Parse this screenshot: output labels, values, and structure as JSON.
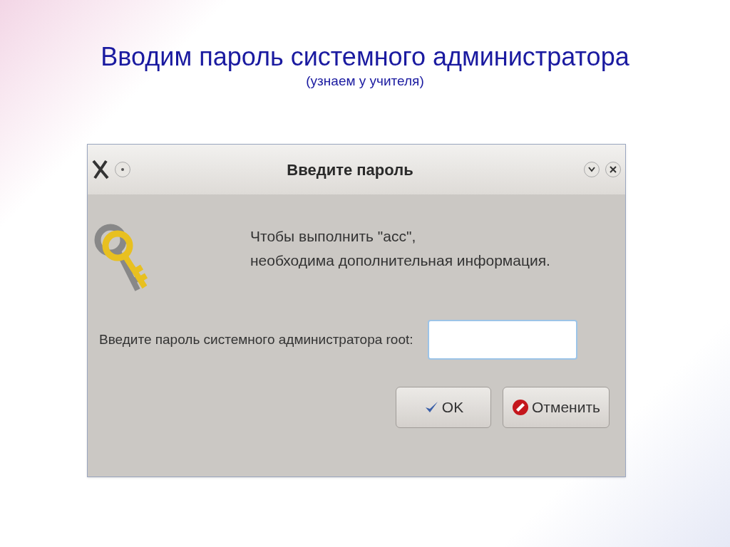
{
  "slide": {
    "title": "Вводим пароль системного администратора",
    "subtitle": "(узнаем у учителя)"
  },
  "dialog": {
    "title": "Введите пароль",
    "message_lines": [
      "Чтобы выполнить \"acc\",",
      "необходима дополнительная информация."
    ],
    "field_label": "Введите пароль системного администратора root:",
    "buttons": [
      {
        "kind": "ok",
        "label": "OK"
      },
      {
        "kind": "cancel",
        "label": "Отменить"
      }
    ]
  }
}
